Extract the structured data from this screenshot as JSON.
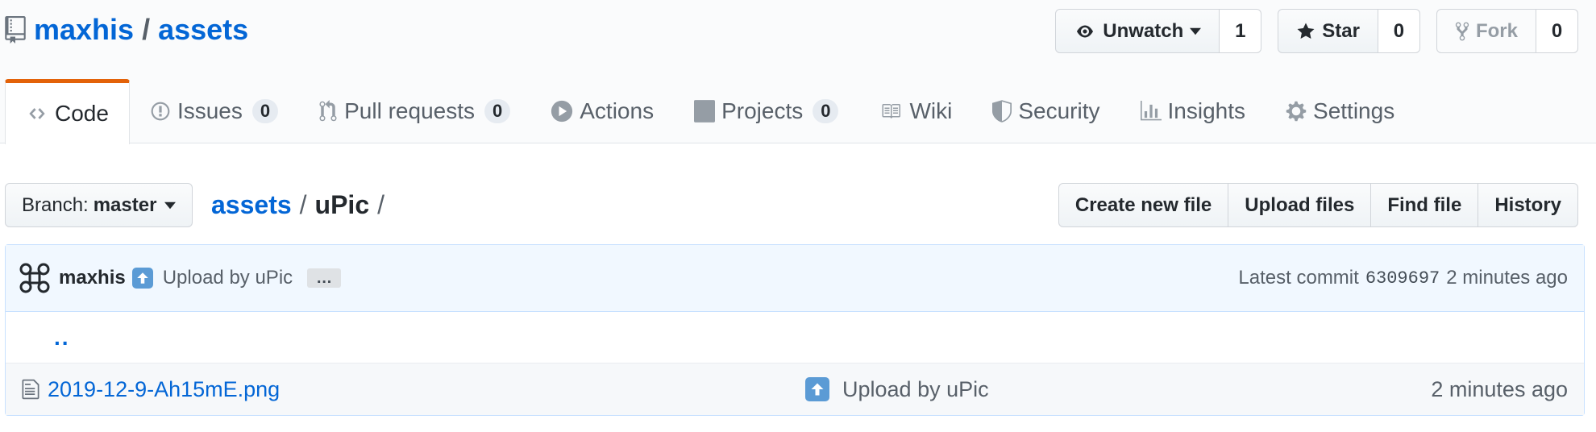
{
  "repo": {
    "owner": "maxhis",
    "separator": "/",
    "name": "assets"
  },
  "actions": {
    "watch": {
      "label": "Unwatch",
      "count": "1"
    },
    "star": {
      "label": "Star",
      "count": "0"
    },
    "fork": {
      "label": "Fork",
      "count": "0"
    }
  },
  "tabs": [
    {
      "label": "Code",
      "icon": "code-icon",
      "selected": true
    },
    {
      "label": "Issues",
      "icon": "issue-icon",
      "count": "0"
    },
    {
      "label": "Pull requests",
      "icon": "pull-request-icon",
      "count": "0"
    },
    {
      "label": "Actions",
      "icon": "play-icon"
    },
    {
      "label": "Projects",
      "icon": "project-icon",
      "count": "0"
    },
    {
      "label": "Wiki",
      "icon": "book-icon"
    },
    {
      "label": "Security",
      "icon": "shield-icon"
    },
    {
      "label": "Insights",
      "icon": "graph-icon"
    },
    {
      "label": "Settings",
      "icon": "gear-icon"
    }
  ],
  "branch": {
    "prefix": "Branch:",
    "name": "master"
  },
  "breadcrumb": {
    "root": "assets",
    "sep": "/",
    "current": "uPic",
    "trailing": "/"
  },
  "file_actions": [
    "Create new file",
    "Upload files",
    "Find file",
    "History"
  ],
  "commit": {
    "author": "maxhis",
    "message": "Upload by uPic",
    "ellipsis": "…",
    "latest_label": "Latest commit",
    "sha": "6309697",
    "age": "2 minutes ago"
  },
  "parent_link": "..",
  "files": [
    {
      "name": "2019-12-9-Ah15mE.png",
      "message": "Upload by uPic",
      "age": "2 minutes ago"
    }
  ],
  "colors": {
    "link": "#0366d6",
    "selected_tab_accent": "#e36209",
    "commit_bg": "#f1f8ff",
    "emoji_bg": "#5b9bd5"
  }
}
